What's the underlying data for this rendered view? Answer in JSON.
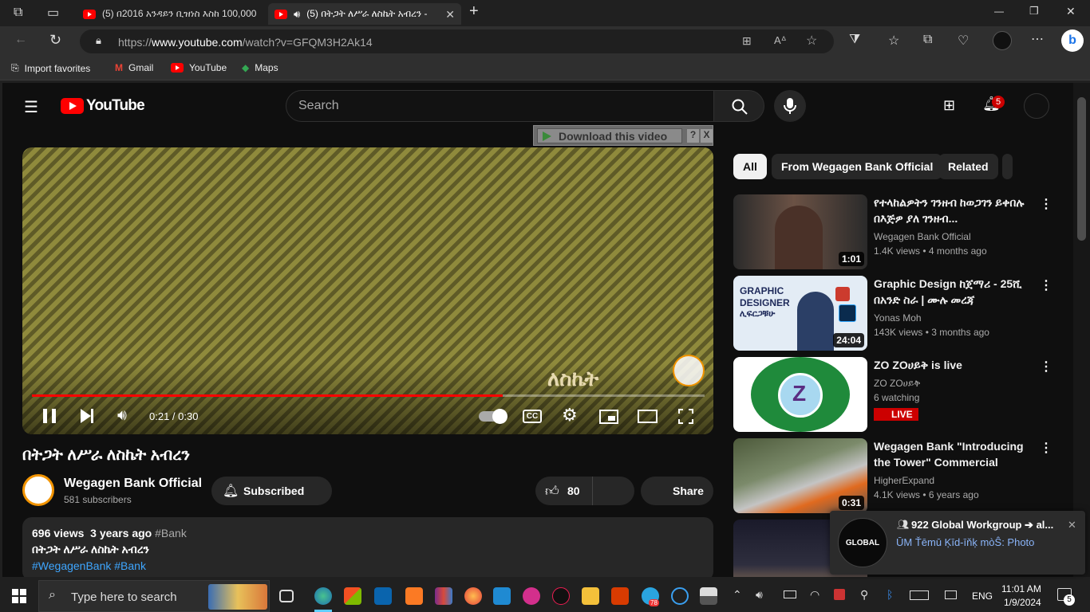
{
  "browser": {
    "tabs": [
      {
        "title": "(5) በ2016 አንዳይን ቢዝነስ እስከ 100,000"
      },
      {
        "title": "(5) በትጋት ለሥራ ለስኬት አብረን -"
      }
    ],
    "new_tab": "+",
    "url_prefix": "https://",
    "url_domain": "www.youtube.com",
    "url_path": "/watch?v=GFQM3H2Ak14",
    "bookmarks": [
      "Import favorites",
      "Gmail",
      "YouTube",
      "Maps"
    ],
    "window_min": "—",
    "window_max": "❐",
    "window_close": "✕"
  },
  "youtube": {
    "logo_text": "YouTube",
    "search_placeholder": "Search",
    "notification_count": "5",
    "download_banner": "Download this video",
    "download_help": "?",
    "download_close": "X",
    "video_watermark_text": "ለስኬት",
    "player": {
      "time": "0:21 / 0:30",
      "progress_fraction": 0.7,
      "cc": "CC"
    },
    "video_title": "በትጋት ለሥራ ለስኬት አብረን",
    "channel_name": "Wegagen Bank Official",
    "subscribers": "581 subscribers",
    "subscribe_label": "Subscribed",
    "like_count": "80",
    "share_label": "Share",
    "description": {
      "views": "696 views",
      "age": "3 years ago",
      "tag": "#Bank",
      "text": "በትጋት ለሥራ ለስኬት አብረን",
      "hashtags": "#WegagenBank #Bank"
    },
    "chips": [
      "All",
      "From Wegagen Bank Official",
      "Related"
    ],
    "recommendations": [
      {
        "title": "የተላከልዎትን ገንዘብ ከወጋገን ይቀበሉ በእጅዎ ያለ ገንዘብ...",
        "channel": "Wegagen Bank Official",
        "views": "1.4K views",
        "age": "4 months ago",
        "duration": "1:01"
      },
      {
        "title": "Graphic Design ከጀማሪ - 25ሺ በአንድ ስራ | ሙሉ መረጃ",
        "channel": "Yonas Moh",
        "views": "143K views",
        "age": "3 months ago",
        "duration": "24:04",
        "thumb_text1": "GRAPHIC",
        "thumb_text2": "DESIGNER",
        "thumb_text3": "ሊፍርጋቹሁ"
      },
      {
        "title": "ZO ZOሀይቅ is live",
        "channel": "ZO ZOሀይቅ",
        "views": "6 watching",
        "live": "LIVE",
        "thumb_letter": "Z"
      },
      {
        "title": "Wegagen Bank \"Introducing the Tower\" Commercial",
        "channel": "HigherExpand",
        "views": "4.1K views",
        "age": "6 years ago",
        "duration": "0:31"
      }
    ]
  },
  "notification": {
    "title": "922 Global Workgroup ➔ al...",
    "body": "ŪM Ťēmū Ķīd-īňķ mòŜ: Photo",
    "avatar_text": "GLOBAL",
    "close": "✕"
  },
  "taskbar": {
    "search_placeholder": "Type here to search",
    "language": "ENG",
    "time": "11:01 AM",
    "date": "1/9/2024",
    "notifications_badge": "5",
    "telegram_badge": "78"
  },
  "colors": {
    "youtube_red": "#ff0000",
    "progress_red": "#ff0000",
    "link_blue": "#3ea6ff",
    "live_red": "#cc0000"
  }
}
